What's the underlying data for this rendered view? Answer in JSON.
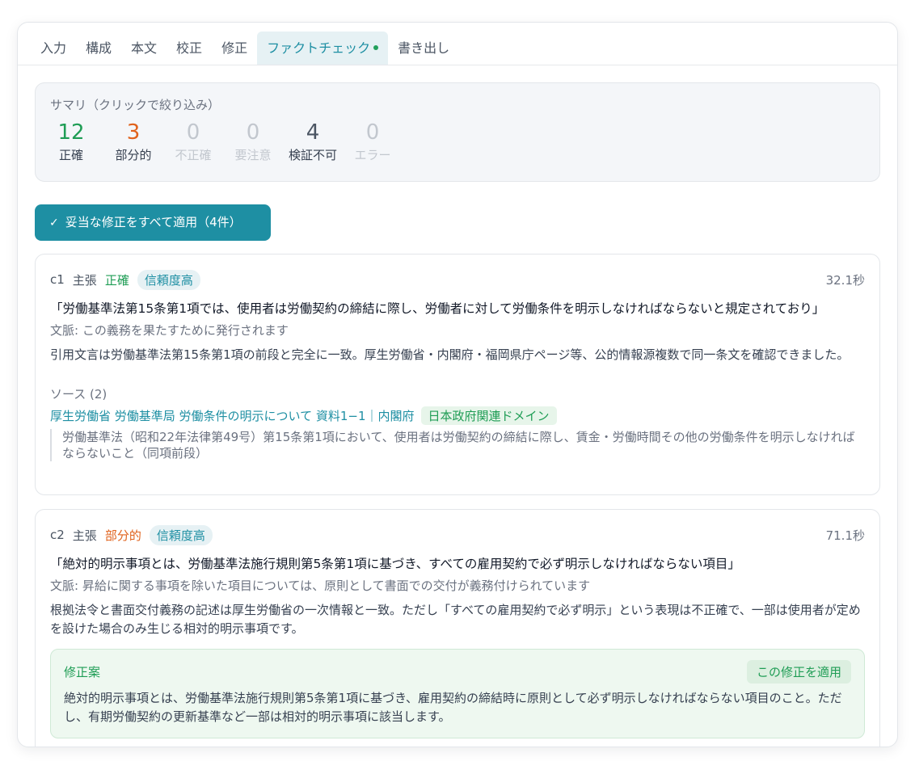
{
  "tabs": [
    {
      "label": "入力"
    },
    {
      "label": "構成"
    },
    {
      "label": "本文"
    },
    {
      "label": "校正"
    },
    {
      "label": "修正"
    },
    {
      "label": "ファクトチェック"
    },
    {
      "label": "書き出し"
    }
  ],
  "summary": {
    "title": "サマリ（クリックで絞り込み）",
    "stats": [
      {
        "num": "12",
        "label": "正確"
      },
      {
        "num": "3",
        "label": "部分的"
      },
      {
        "num": "0",
        "label": "不正確"
      },
      {
        "num": "0",
        "label": "要注意"
      },
      {
        "num": "4",
        "label": "検証不可"
      },
      {
        "num": "0",
        "label": "エラー"
      }
    ]
  },
  "apply_all": {
    "icon": "check-icon",
    "label": "妥当な修正をすべて適用（4件）"
  },
  "claims": [
    {
      "id": "c1",
      "type": "主張",
      "verdict": "正確",
      "confidence": "信頼度高",
      "time": "32.1秒",
      "text": "「労働基準法第15条第1項では、使用者は労働契約の締結に際し、労働者に対して労働条件を明示しなければならないと規定されており」",
      "context": "文脈: この義務を果たすために発行されます",
      "reason": "引用文言は労働基準法第15条第1項の前段と完全に一致。厚生労働省・内閣府・福岡県庁ページ等、公的情報源複数で同一条文を確認できました。",
      "sources_title": "ソース (2)",
      "source_link": "厚生労働省 労働基準局 労働条件の明示について 資料1−1｜内閣府",
      "source_badge": "日本政府関連ドメイン",
      "source_quote": "労働基準法（昭和22年法律第49号）第15条第1項において、使用者は労働契約の締結に際し、賃金・労働時間その他の労働条件を明示しなければならないこと（同項前段）"
    },
    {
      "id": "c2",
      "type": "主張",
      "verdict": "部分的",
      "confidence": "信頼度高",
      "time": "71.1秒",
      "text": "「絶対的明示事項とは、労働基準法施行規則第5条第1項に基づき、すべての雇用契約で必ず明示しなければならない項目」",
      "context": "文脈: 昇給に関する事項を除いた項目については、原則として書面での交付が義務付けられています",
      "reason": "根拠法令と書面交付義務の記述は厚生労働省の一次情報と一致。ただし「すべての雇用契約で必ず明示」という表現は不正確で、一部は使用者が定めを設けた場合のみ生じる相対的明示事項です。",
      "fix": {
        "title": "修正案",
        "apply_label": "この修正を適用",
        "text": "絶対的明示事項とは、労働基準法施行規則第5条第1項に基づき、雇用契約の締結時に原則として必ず明示しなければならない項目のこと。ただし、有期労働契約の更新基準など一部は相対的明示事項に該当します。"
      }
    }
  ],
  "colors": {
    "accent": "#1e8fa3",
    "ok": "#1f9d55",
    "partial": "#e0621c",
    "muted": "#c2c7ce"
  }
}
